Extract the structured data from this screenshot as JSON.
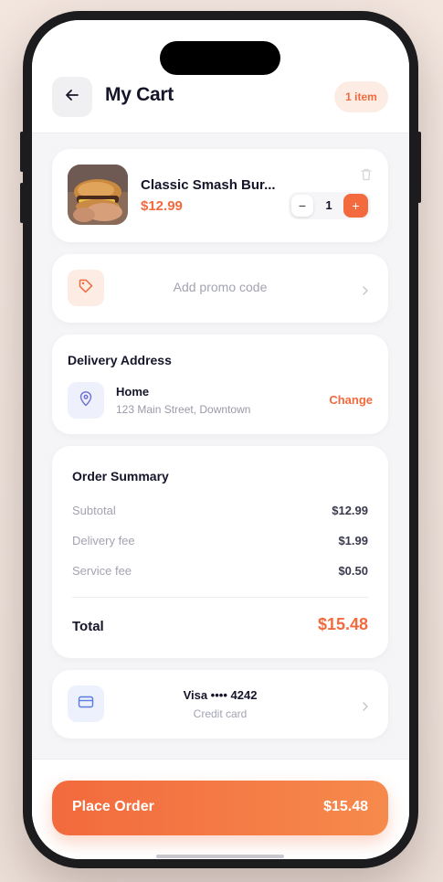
{
  "header": {
    "title": "My Cart",
    "item_badge": "1 item"
  },
  "cart_item": {
    "name": "Classic Smash Bur...",
    "price": "$12.99",
    "quantity": "1",
    "minus_label": "−",
    "plus_label": "+"
  },
  "promo": {
    "placeholder": "Add promo code"
  },
  "delivery": {
    "section_title": "Delivery Address",
    "label": "Home",
    "address": "123 Main Street, Downtown",
    "change_label": "Change"
  },
  "summary": {
    "section_title": "Order Summary",
    "rows": [
      {
        "label": "Subtotal",
        "value": "$12.99"
      },
      {
        "label": "Delivery fee",
        "value": "$1.99"
      },
      {
        "label": "Service fee",
        "value": "$0.50"
      }
    ],
    "total_label": "Total",
    "total_value": "$15.48"
  },
  "payment": {
    "method": "Visa •••• 4242",
    "type": "Credit card"
  },
  "footer": {
    "place_order_label": "Place Order",
    "place_order_amount": "$15.48"
  },
  "colors": {
    "accent": "#f26a3d",
    "accent_light": "#fdece4",
    "text_dark": "#15152a",
    "text_muted": "#a3a3b3",
    "background": "#f5f5f7"
  },
  "icons": {
    "back": "arrow-left-icon",
    "trash": "trash-icon",
    "promo": "tag-icon",
    "location": "map-pin-icon",
    "card": "credit-card-icon",
    "chevron": "chevron-right-icon"
  }
}
